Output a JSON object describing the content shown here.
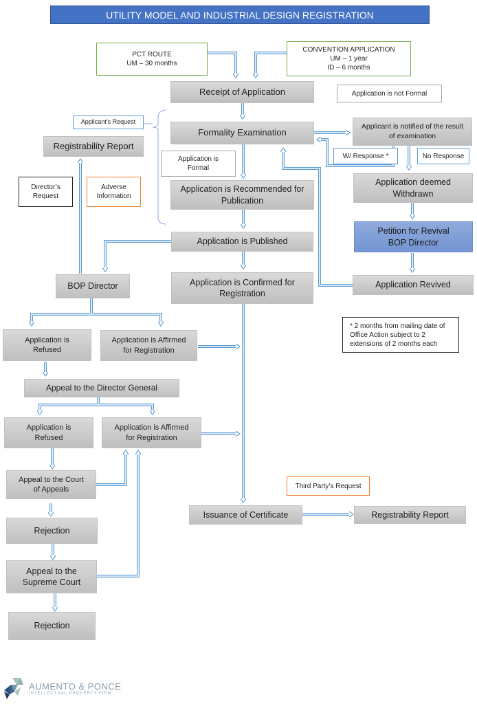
{
  "title": "UTILITY MODEL AND INDUSTRIAL DESIGN REGISTRATION",
  "colors": {
    "title_bg": "#4472c4",
    "step_gray": "#c9c9c9",
    "revival_blue": "#7f9fd8",
    "connector": "#5b9bd5",
    "green_border": "#70ad47",
    "orange_border": "#ed7d31"
  },
  "nodes": {
    "pct_route": "PCT ROUTE\nUM – 30 months",
    "convention": "CONVENTION APPLICATION\nUM – 1 year\nID – 6 months",
    "receipt": "Receipt of Application",
    "not_formal": "Application is not Formal",
    "applicants_request": "Applicant’s Request",
    "registrability_report_top": "Registrability Report",
    "formality_exam": "Formality Examination",
    "notified": "Applicant is notified of the result\nof examination",
    "w_response": "W/ Response *",
    "no_response": "No Response",
    "is_formal": "Application is\nFormal",
    "recommended": "Application is Recommended for\nPublication",
    "deemed_withdrawn": "Application deemed\nWithdrawn",
    "directors_request": "Director’s\nRequest",
    "adverse_info": "Adverse\nInformation",
    "petition_revival": "Petition for Revival\nBOP Director",
    "published": "Application is Published",
    "bop_director": "BOP Director",
    "confirmed": "Application is Confirmed for\nRegistration",
    "revived": "Application Revived",
    "footnote": "* 2 months from mailing date of\nOffice Action subject to 2\nextensions of 2 months each",
    "refused_1": "Application is\nRefused",
    "affirmed_1": "Application is Affirmed\nfor Registration",
    "appeal_dg": "Appeal to the Director General",
    "refused_2": "Application is\nRefused",
    "affirmed_2": "Application is Affirmed\nfor Registration",
    "appeal_ca": "Appeal to the Court\nof Appeals",
    "third_party": "Third Party’s Request",
    "issuance": "Issuance of Certificate",
    "registrability_report_bottom": "Registrability Report",
    "rejection_1": "Rejection",
    "appeal_sc": "Appeal to the\nSupreme Court",
    "rejection_2": "Rejection"
  },
  "logo": {
    "name": "AUMENTO & PONCE",
    "tagline": "INTELLECTUAL PROPERTY FIRM"
  }
}
